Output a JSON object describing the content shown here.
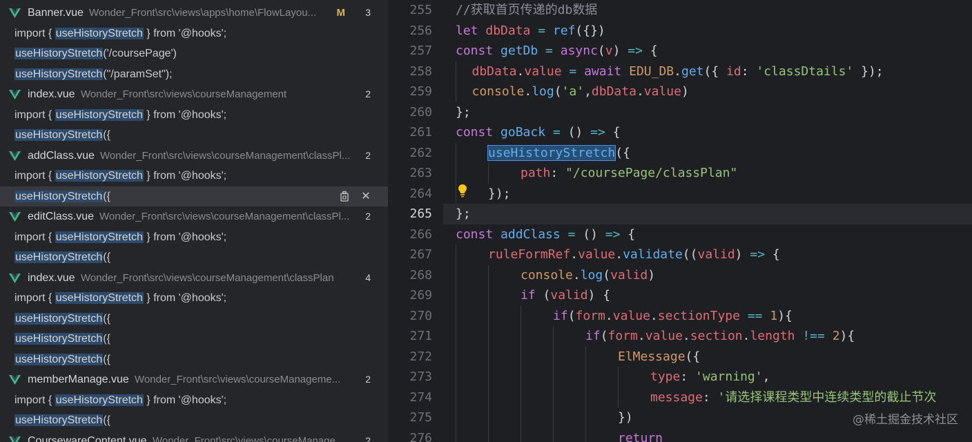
{
  "search_results": [
    {
      "type": "file",
      "name": "Banner.vue",
      "path": "Wonder_Front\\src\\views\\apps\\home\\FlowLayou...",
      "status": "M",
      "count": "3"
    },
    {
      "type": "match",
      "pre": "import { ",
      "hl": "useHistoryStretch",
      "post": " } from '@hooks';"
    },
    {
      "type": "match",
      "pre": "",
      "hl": "useHistoryStretch",
      "post": "('/coursePage')"
    },
    {
      "type": "match",
      "pre": "",
      "hl": "useHistoryStretch",
      "post": "(\"/paramSet\");"
    },
    {
      "type": "file",
      "name": "index.vue",
      "path": "Wonder_Front\\src\\views\\courseManagement",
      "status": "",
      "count": "2"
    },
    {
      "type": "match",
      "pre": "import { ",
      "hl": "useHistoryStretch",
      "post": " } from '@hooks';"
    },
    {
      "type": "match",
      "pre": "",
      "hl": "useHistoryStretch",
      "post": "({"
    },
    {
      "type": "file",
      "name": "addClass.vue",
      "path": "Wonder_Front\\src\\views\\courseManagement\\classPl...",
      "status": "",
      "count": "2"
    },
    {
      "type": "match",
      "pre": "import { ",
      "hl": "useHistoryStretch",
      "post": " } from '@hooks';"
    },
    {
      "type": "match",
      "pre": "",
      "hl": "useHistoryStretch",
      "post": "({",
      "selected": true
    },
    {
      "type": "file",
      "name": "editClass.vue",
      "path": "Wonder_Front\\src\\views\\courseManagement\\classPl...",
      "status": "",
      "count": "2"
    },
    {
      "type": "match",
      "pre": "import { ",
      "hl": "useHistoryStretch",
      "post": " } from '@hooks';"
    },
    {
      "type": "match",
      "pre": "",
      "hl": "useHistoryStretch",
      "post": "({"
    },
    {
      "type": "file",
      "name": "index.vue",
      "path": "Wonder_Front\\src\\views\\courseManagement\\classPlan",
      "status": "",
      "count": "4"
    },
    {
      "type": "match",
      "pre": "import { ",
      "hl": "useHistoryStretch",
      "post": " } from '@hooks';"
    },
    {
      "type": "match",
      "pre": "",
      "hl": "useHistoryStretch",
      "post": "({"
    },
    {
      "type": "match",
      "pre": "",
      "hl": "useHistoryStretch",
      "post": "({"
    },
    {
      "type": "match",
      "pre": "",
      "hl": "useHistoryStretch",
      "post": "({"
    },
    {
      "type": "file",
      "name": "memberManage.vue",
      "path": "Wonder_Front\\src\\views\\courseManageme...",
      "status": "",
      "count": "2"
    },
    {
      "type": "match",
      "pre": "import { ",
      "hl": "useHistoryStretch",
      "post": " } from '@hooks';"
    },
    {
      "type": "match",
      "pre": "",
      "hl": "useHistoryStretch",
      "post": "({"
    },
    {
      "type": "file",
      "name": "CoursewareContent.vue",
      "path": "Wonder_Front\\src\\views\\courseManage...",
      "status": "",
      "count": "2"
    }
  ],
  "editor": {
    "active_line": "265",
    "lines": [
      {
        "n": "255",
        "indent": 0,
        "tokens": [
          [
            "comment",
            "//获取首页传递的db数据"
          ]
        ]
      },
      {
        "n": "256",
        "indent": 0,
        "tokens": [
          [
            "kw",
            "let "
          ],
          [
            "var",
            "dbData"
          ],
          [
            "op",
            " = "
          ],
          [
            "fn",
            "ref"
          ],
          [
            "brace",
            "({})"
          ]
        ]
      },
      {
        "n": "257",
        "indent": 0,
        "tokens": [
          [
            "kw",
            "const "
          ],
          [
            "fn",
            "getDb"
          ],
          [
            "op",
            " = "
          ],
          [
            "kw",
            "async"
          ],
          [
            "brace",
            "("
          ],
          [
            "var",
            "v"
          ],
          [
            "brace",
            ")"
          ],
          [
            "op",
            " => "
          ],
          [
            "brace",
            "{"
          ]
        ]
      },
      {
        "n": "258",
        "indent": 1,
        "tokens": [
          [
            "var",
            "dbData"
          ],
          [
            "brace",
            "."
          ],
          [
            "var",
            "value"
          ],
          [
            "op",
            " = "
          ],
          [
            "kw",
            "await "
          ],
          [
            "num",
            "EDU_DB"
          ],
          [
            "brace",
            "."
          ],
          [
            "fn",
            "get"
          ],
          [
            "brace",
            "({ "
          ],
          [
            "prop",
            "id"
          ],
          [
            "brace",
            ": "
          ],
          [
            "str",
            "'classDtails'"
          ],
          [
            "brace",
            " });"
          ]
        ]
      },
      {
        "n": "259",
        "indent": 1,
        "tokens": [
          [
            "num",
            "console"
          ],
          [
            "brace",
            "."
          ],
          [
            "fn",
            "log"
          ],
          [
            "brace",
            "("
          ],
          [
            "str",
            "'a'"
          ],
          [
            "brace",
            ","
          ],
          [
            "var",
            "dbData"
          ],
          [
            "brace",
            "."
          ],
          [
            "var",
            "value"
          ],
          [
            "brace",
            ")"
          ]
        ]
      },
      {
        "n": "260",
        "indent": 0,
        "tokens": [
          [
            "brace",
            "};"
          ]
        ]
      },
      {
        "n": "261",
        "indent": 0,
        "tokens": [
          [
            "kw",
            "const "
          ],
          [
            "fn",
            "goBack"
          ],
          [
            "op",
            " = "
          ],
          [
            "brace",
            "() "
          ],
          [
            "op",
            "=> "
          ],
          [
            "brace",
            "{"
          ]
        ]
      },
      {
        "n": "262",
        "indent": 2,
        "tokens": [
          [
            "hl",
            "useHistoryStretch"
          ],
          [
            "brace",
            "({"
          ]
        ]
      },
      {
        "n": "263",
        "indent": 4,
        "tokens": [
          [
            "prop",
            "path"
          ],
          [
            "brace",
            ": "
          ],
          [
            "str",
            "\"/coursePage/classPlan\""
          ]
        ]
      },
      {
        "n": "264",
        "indent": 2,
        "tokens": [
          [
            "brace",
            "});"
          ]
        ]
      },
      {
        "n": "265",
        "indent": 0,
        "tokens": [
          [
            "brace",
            "};"
          ]
        ]
      },
      {
        "n": "266",
        "indent": 0,
        "tokens": [
          [
            "kw",
            "const "
          ],
          [
            "fn",
            "addClass"
          ],
          [
            "op",
            " = "
          ],
          [
            "brace",
            "() "
          ],
          [
            "op",
            "=> "
          ],
          [
            "brace",
            "{"
          ]
        ]
      },
      {
        "n": "267",
        "indent": 2,
        "tokens": [
          [
            "var",
            "ruleFormRef"
          ],
          [
            "brace",
            "."
          ],
          [
            "var",
            "value"
          ],
          [
            "brace",
            "."
          ],
          [
            "fn",
            "validate"
          ],
          [
            "brace",
            "(("
          ],
          [
            "var",
            "valid"
          ],
          [
            "brace",
            ") "
          ],
          [
            "op",
            "=> "
          ],
          [
            "brace",
            "{"
          ]
        ]
      },
      {
        "n": "268",
        "indent": 4,
        "tokens": [
          [
            "num",
            "console"
          ],
          [
            "brace",
            "."
          ],
          [
            "fn",
            "log"
          ],
          [
            "brace",
            "("
          ],
          [
            "var",
            "valid"
          ],
          [
            "brace",
            ")"
          ]
        ]
      },
      {
        "n": "269",
        "indent": 4,
        "tokens": [
          [
            "kw",
            "if "
          ],
          [
            "brace",
            "("
          ],
          [
            "var",
            "valid"
          ],
          [
            "brace",
            ") {"
          ]
        ]
      },
      {
        "n": "270",
        "indent": 6,
        "tokens": [
          [
            "kw",
            "if"
          ],
          [
            "brace",
            "("
          ],
          [
            "var",
            "form"
          ],
          [
            "brace",
            "."
          ],
          [
            "var",
            "value"
          ],
          [
            "brace",
            "."
          ],
          [
            "var",
            "sectionType"
          ],
          [
            "op",
            " == "
          ],
          [
            "num",
            "1"
          ],
          [
            "brace",
            "){"
          ]
        ]
      },
      {
        "n": "271",
        "indent": 8,
        "tokens": [
          [
            "kw",
            "if"
          ],
          [
            "brace",
            "("
          ],
          [
            "var",
            "form"
          ],
          [
            "brace",
            "."
          ],
          [
            "var",
            "value"
          ],
          [
            "brace",
            "."
          ],
          [
            "var",
            "section"
          ],
          [
            "brace",
            "."
          ],
          [
            "var",
            "length"
          ],
          [
            "op",
            " !== "
          ],
          [
            "num",
            "2"
          ],
          [
            "brace",
            "){"
          ]
        ]
      },
      {
        "n": "272",
        "indent": 10,
        "tokens": [
          [
            "num",
            "ElMessage"
          ],
          [
            "brace",
            "({"
          ]
        ]
      },
      {
        "n": "273",
        "indent": 12,
        "tokens": [
          [
            "prop",
            "type"
          ],
          [
            "brace",
            ": "
          ],
          [
            "str",
            "'warning'"
          ],
          [
            "brace",
            ","
          ]
        ]
      },
      {
        "n": "274",
        "indent": 12,
        "tokens": [
          [
            "prop",
            "message"
          ],
          [
            "brace",
            ": "
          ],
          [
            "str",
            "'请选择课程类型中连续类型的截止节次"
          ]
        ]
      },
      {
        "n": "275",
        "indent": 10,
        "tokens": [
          [
            "brace",
            "})"
          ]
        ]
      },
      {
        "n": "276",
        "indent": 10,
        "tokens": [
          [
            "kw",
            "return"
          ]
        ]
      }
    ]
  },
  "watermark": "@稀土掘金技术社区",
  "colors": {
    "vue_green": "#41b883",
    "vue_dark": "#35495e",
    "modified": "#d9b15a"
  }
}
